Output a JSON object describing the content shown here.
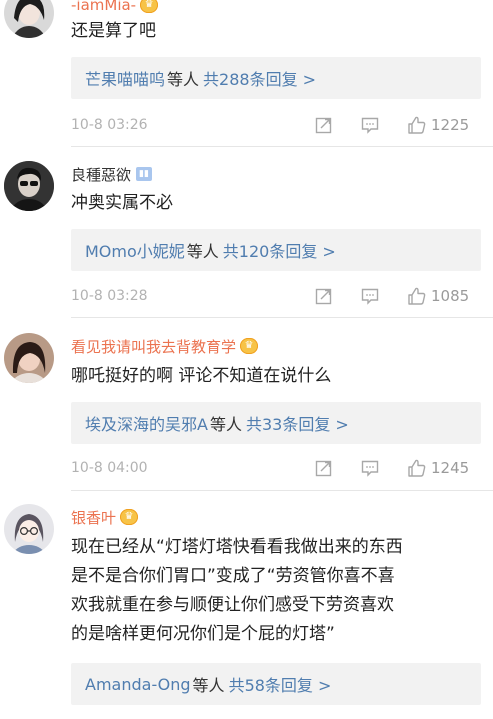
{
  "comments": [
    {
      "username": "-iamMia-",
      "text_lines": [
        "还是算了吧"
      ],
      "reply_names": "芒果喵喵呜",
      "reply_mid": "等人",
      "reply_count": "共288条回复 >",
      "time": "10-8 03:26",
      "likes": "1225"
    },
    {
      "username": "良種惡欲",
      "text_lines": [
        "冲奥实属不必"
      ],
      "reply_names": "MOmo小妮妮",
      "reply_mid": "等人",
      "reply_count": "共120条回复 >",
      "time": "10-8 03:28",
      "likes": "1085"
    },
    {
      "username": "看见我请叫我去背教育学",
      "text_lines": [
        "哪吒挺好的啊 评论不知道在说什么"
      ],
      "reply_names": "埃及深海的吴邪A",
      "reply_mid": "等人",
      "reply_count": "共33条回复 >",
      "time": "10-8 04:00",
      "likes": "1245"
    },
    {
      "username": "银香叶",
      "text_lines": [
        "现在已经从“灯塔灯塔快看看我做出来的东西",
        "是不是合你们胃口”变成了“劳资管你喜不喜",
        "欢我就重在参与顺便让你们感受下劳资喜欢",
        "的是啥样更何况你们是个屁的灯塔”"
      ],
      "reply_names": "Amanda-Ong",
      "reply_mid": "等人",
      "reply_count": "共58条回复 >",
      "time": "",
      "likes": ""
    }
  ],
  "colors": {
    "username_vip": "#eb7350",
    "link_blue": "#507daf",
    "reply_bg": "#f2f2f2",
    "meta_gray": "#b2b2b2"
  },
  "icons": {
    "vip_badge": "crown-badge-icon",
    "member_badge": "member-badge-icon",
    "share": "share-icon",
    "comment": "comment-icon",
    "like": "thumbs-up-icon"
  }
}
